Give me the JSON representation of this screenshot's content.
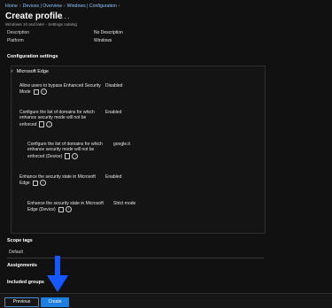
{
  "breadcrumb": [
    "Home",
    "Devices | Overview",
    "Windows | Configuration"
  ],
  "page": {
    "title": "Create profile",
    "more": "...",
    "subtitle": "Windows 10 and later - Settings catalog"
  },
  "basics": [
    {
      "label": "Description",
      "value": "No Description"
    },
    {
      "label": "Platform",
      "value": "Windows"
    }
  ],
  "configuration": {
    "heading": "Configuration settings",
    "group": "Microsoft Edge",
    "settings": [
      {
        "label_lines": [
          "Allow users to bypass Enhanced Security",
          "Mode"
        ],
        "value": "Disabled"
      },
      {
        "label_lines": [
          "Configure the list of domains for which",
          "enhance security mode will not be",
          "enforced"
        ],
        "value": "Enabled"
      },
      {
        "label_lines": [
          "Configure the list of domains for which",
          "enhance security mode will not be",
          "enforced (Device)"
        ],
        "value": "google.it"
      },
      {
        "label_lines": [
          "Enhance the security state in Microsoft",
          "Edge"
        ],
        "value": "Enabled"
      },
      {
        "label_lines": [
          "Enhance the security state in Microsoft",
          "Edge (Device)"
        ],
        "value": "Strict mode"
      }
    ]
  },
  "scope_tags": {
    "heading": "Scope tags",
    "value": "Default"
  },
  "assignments": {
    "heading": "Assignments"
  },
  "included_groups": {
    "heading": "Included groups"
  },
  "footer": {
    "previous_label": "Previous",
    "create_label": "Create"
  },
  "colors": {
    "accent": "#1f7fe0",
    "arrow": "#1658ff",
    "background": "#111111"
  }
}
